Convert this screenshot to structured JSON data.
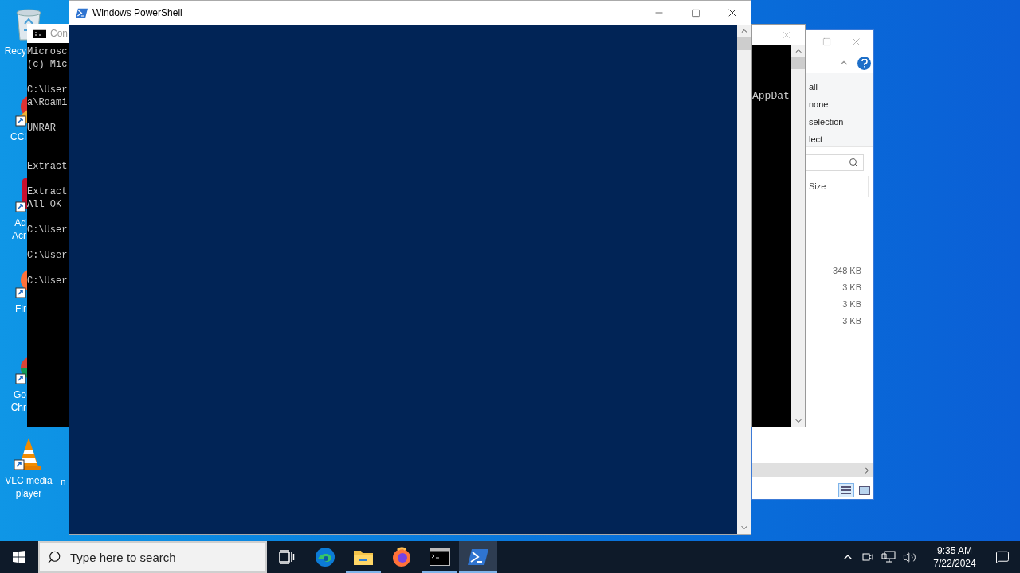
{
  "desktop_icons": [
    {
      "kind": "recycle",
      "lines": [
        "Recy"
      ],
      "covered": true
    },
    {
      "kind": "cleaner",
      "lines": [
        "CCl"
      ],
      "covered": true
    },
    {
      "kind": "pdf",
      "lines": [
        "Ad",
        "Acr"
      ],
      "covered": true
    },
    {
      "kind": "firefox",
      "lines": [
        "Fir"
      ],
      "covered": true
    },
    {
      "kind": "chrome",
      "lines": [
        "Go",
        "Chr"
      ],
      "covered": true
    },
    {
      "kind": "vlc",
      "lines": [
        "VLC media",
        "player"
      ],
      "covered": false
    }
  ],
  "desktop_icons_column_2": [
    {
      "lines": [
        "n"
      ]
    }
  ],
  "console_window": {
    "title": "Con",
    "lines": [
      {
        "kind": "text",
        "text": "Microsc"
      },
      {
        "kind": "text",
        "text": "(c) Mic"
      },
      {
        "kind": "blank"
      },
      {
        "kind": "text",
        "text": "C:\\User"
      },
      {
        "kind": "text",
        "text": "a\\Roami"
      },
      {
        "kind": "blank"
      },
      {
        "kind": "text",
        "text": "UNRAR"
      },
      {
        "kind": "blank"
      },
      {
        "kind": "blank"
      },
      {
        "kind": "text",
        "text": "Extract"
      },
      {
        "kind": "blank"
      },
      {
        "kind": "text",
        "text": "Extract"
      },
      {
        "kind": "text",
        "text": "All OK"
      },
      {
        "kind": "blank"
      },
      {
        "kind": "text",
        "text": "C:\\User"
      },
      {
        "kind": "blank"
      },
      {
        "kind": "text",
        "text": "C:\\User"
      },
      {
        "kind": "blank"
      },
      {
        "kind": "text",
        "text": "C:\\User"
      }
    ]
  },
  "console_window_2": {
    "lines": [
      {
        "kind": "blank"
      },
      {
        "kind": "blank"
      },
      {
        "kind": "blank"
      },
      {
        "kind": "text",
        "text": "AppDat"
      }
    ]
  },
  "explorer_window": {
    "ribbon_items": [
      "all",
      "none",
      "selection",
      "lect"
    ],
    "columns": [
      "Size"
    ],
    "rows": [
      {
        "size": "348 KB"
      },
      {
        "size": "3 KB"
      },
      {
        "size": "3 KB"
      },
      {
        "size": "3 KB"
      }
    ]
  },
  "powershell_window": {
    "title": "Windows PowerShell"
  },
  "taskbar": {
    "search": {
      "placeholder": "Type here to search"
    },
    "apps": [
      {
        "kind": "task-view",
        "running": false,
        "selected": false
      },
      {
        "kind": "edge",
        "running": false,
        "selected": false
      },
      {
        "kind": "explorer",
        "running": true,
        "selected": false
      },
      {
        "kind": "firefox",
        "running": false,
        "selected": false
      },
      {
        "kind": "console",
        "running": true,
        "selected": false
      },
      {
        "kind": "powershell",
        "running": true,
        "selected": true
      }
    ],
    "time": "9:35 AM",
    "date": "7/22/2024"
  }
}
